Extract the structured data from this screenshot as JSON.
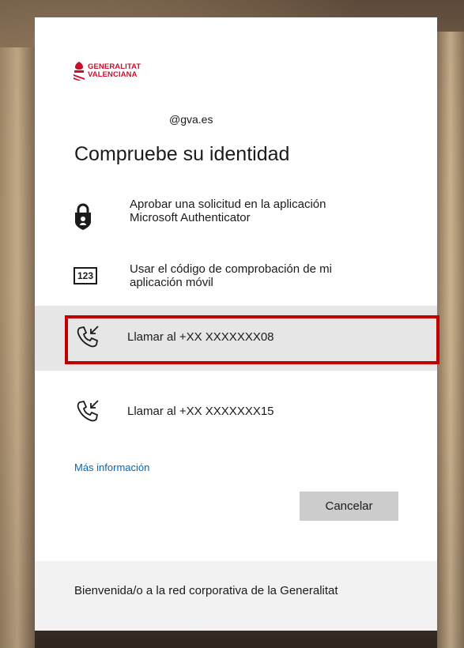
{
  "brand": {
    "line1": "GENERALITAT",
    "line2": "VALENCIANA",
    "color": "#c8102e"
  },
  "account": {
    "email": "@gva.es"
  },
  "title": "Compruebe su identidad",
  "options": [
    {
      "icon": "authenticator-lock-icon",
      "line1": "Aprobar una solicitud en la aplicación",
      "line2": "Microsoft Authenticator"
    },
    {
      "icon": "code-123-icon",
      "icon_text": "123",
      "line1": "Usar el código de comprobación de mi",
      "line2": "aplicación móvil"
    },
    {
      "icon": "phone-call-icon",
      "line1": "Llamar al +XX XXXXXXX08",
      "selected": true
    },
    {
      "icon": "phone-call-icon",
      "line1": "Llamar al +XX XXXXXXX15"
    }
  ],
  "more_info_link": "Más información",
  "cancel_button": "Cancelar",
  "footer_text": "Bienvenida/o a la red corporativa de la Generalitat",
  "colors": {
    "link": "#0067b8",
    "highlight_border": "#c00000",
    "selected_bg": "#e6e6e6",
    "button_bg": "#cccccc"
  }
}
